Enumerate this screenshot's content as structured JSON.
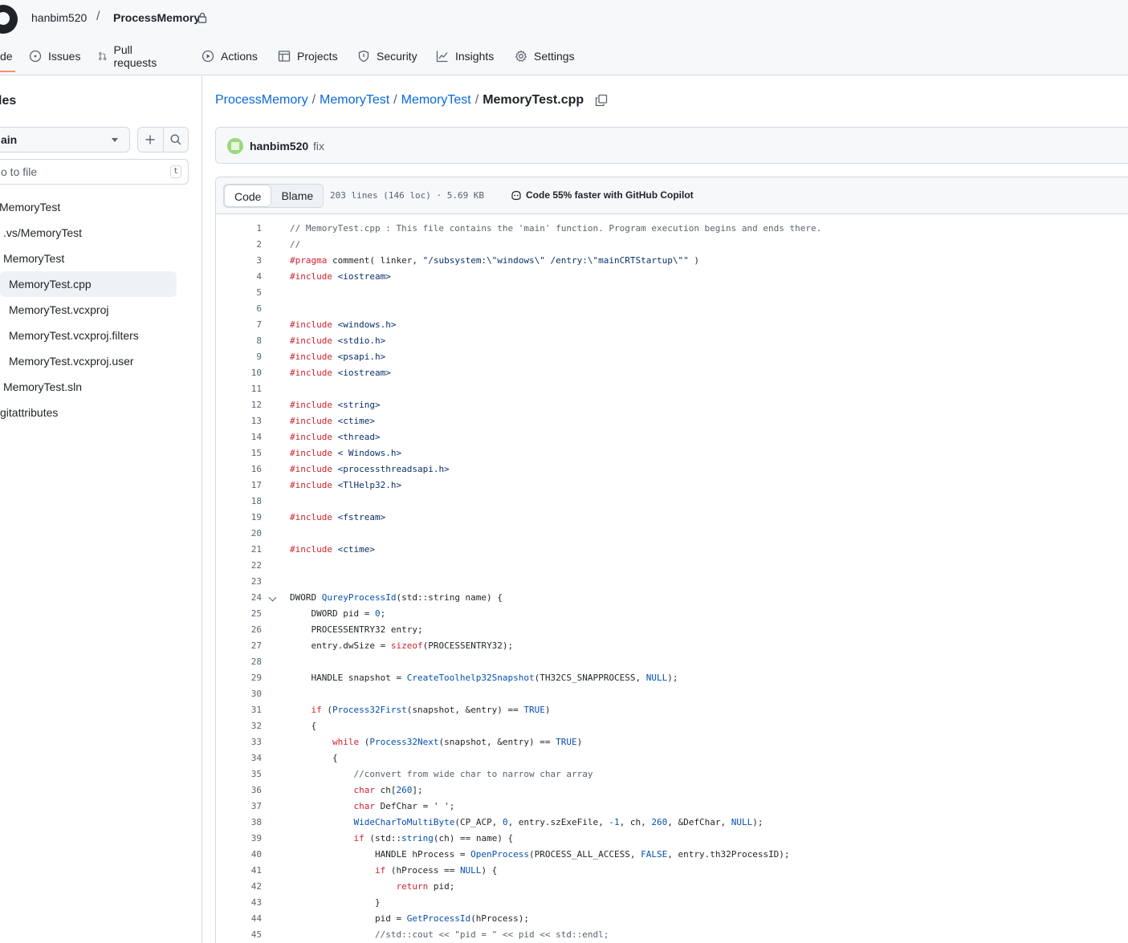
{
  "header": {
    "owner": "hanbim520",
    "separator": "/",
    "repo": "ProcessMemory"
  },
  "nav": [
    {
      "label": "de",
      "icon": "code-icon",
      "active": true
    },
    {
      "label": "Issues",
      "icon": "issue-icon"
    },
    {
      "label": "Pull requests",
      "icon": "pull-request-icon"
    },
    {
      "label": "Actions",
      "icon": "play-icon"
    },
    {
      "label": "Projects",
      "icon": "table-icon"
    },
    {
      "label": "Security",
      "icon": "shield-icon"
    },
    {
      "label": "Insights",
      "icon": "graph-icon"
    },
    {
      "label": "Settings",
      "icon": "gear-icon"
    }
  ],
  "sidebar": {
    "title": "les",
    "branch": "ain",
    "goto_placeholder": "o to file",
    "goto_shortcut": "t",
    "tree": [
      {
        "label": "MemoryTest"
      },
      {
        "label": ".vs/MemoryTest"
      },
      {
        "label": "MemoryTest"
      },
      {
        "label": "MemoryTest.cpp",
        "selected": true
      },
      {
        "label": "MemoryTest.vcxproj"
      },
      {
        "label": "MemoryTest.vcxproj.filters"
      },
      {
        "label": "MemoryTest.vcxproj.user"
      },
      {
        "label": "MemoryTest.sln"
      },
      {
        "label": "gitattributes"
      }
    ]
  },
  "breadcrumb": {
    "parts": [
      "ProcessMemory",
      "MemoryTest",
      "MemoryTest"
    ],
    "separator": "/",
    "current": "MemoryTest.cpp"
  },
  "commit": {
    "author": "hanbim520",
    "message": "fix"
  },
  "file": {
    "tabs": [
      "Code",
      "Blame"
    ],
    "active_tab": "Code",
    "meta": "203 lines (146 loc) · 5.69 KB",
    "copilot": "Code 55% faster with GitHub Copilot"
  },
  "colors": {
    "keyword": "#cf222e",
    "function": "#0550ae",
    "constant": "#0550ae",
    "string": "#0a3069",
    "comment": "#59636e",
    "accent": "#fd8c73",
    "link": "#0969da"
  },
  "code_lines": [
    "// MemoryTest.cpp : This file contains the 'main' function. Program execution begins and ends there.",
    "//",
    "#pragma comment( linker, \"/subsystem:\\\"windows\\\" /entry:\\\"mainCRTStartup\\\"\" )",
    "#include <iostream>",
    "",
    "",
    "#include <windows.h>",
    "#include <stdio.h>",
    "#include <psapi.h>",
    "#include <iostream>",
    "",
    "#include <string>",
    "#include <ctime>",
    "#include <thread>",
    "#include < Windows.h>",
    "#include <processthreadsapi.h>",
    "#include <TlHelp32.h>",
    "",
    "#include <fstream>",
    "",
    "#include <ctime>",
    "",
    "",
    "DWORD QureyProcessId(std::string name) {",
    "    DWORD pid = 0;",
    "    PROCESSENTRY32 entry;",
    "    entry.dwSize = sizeof(PROCESSENTRY32);",
    "",
    "    HANDLE snapshot = CreateToolhelp32Snapshot(TH32CS_SNAPPROCESS, NULL);",
    "",
    "    if (Process32First(snapshot, &entry) == TRUE)",
    "    {",
    "        while (Process32Next(snapshot, &entry) == TRUE)",
    "        {",
    "            //convert from wide char to narrow char array",
    "            char ch[260];",
    "            char DefChar = ' ';",
    "            WideCharToMultiByte(CP_ACP, 0, entry.szExeFile, -1, ch, 260, &DefChar, NULL);",
    "            if (std::string(ch) == name) {",
    "                HANDLE hProcess = OpenProcess(PROCESS_ALL_ACCESS, FALSE, entry.th32ProcessID);",
    "                if (hProcess == NULL) {",
    "                    return pid;",
    "                }",
    "                pid = GetProcessId(hProcess);",
    "                //std::cout << \"pid = \" << pid << std::endl;"
  ],
  "fold_line": 24
}
